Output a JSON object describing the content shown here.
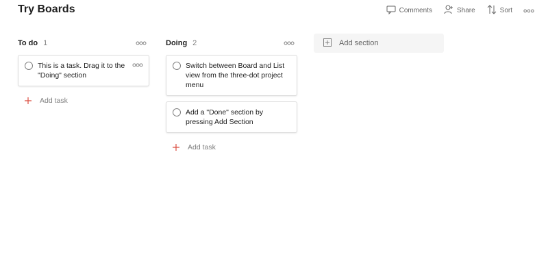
{
  "page": {
    "title": "Try Boards"
  },
  "toolbar": {
    "comments_label": "Comments",
    "share_label": "Share",
    "sort_label": "Sort"
  },
  "columns": [
    {
      "title": "To do",
      "count": "1",
      "tasks": [
        {
          "text": "This is a task. Drag it to the \"Doing\" section"
        }
      ],
      "add_task_label": "Add task"
    },
    {
      "title": "Doing",
      "count": "2",
      "tasks": [
        {
          "text": "Switch between Board and List view from the three-dot project menu"
        },
        {
          "text": "Add a \"Done\" section by pressing Add Section"
        }
      ],
      "add_task_label": "Add task"
    }
  ],
  "add_section": {
    "label": "Add section"
  },
  "colors": {
    "accent": "#db4c3f",
    "text": "#202020",
    "muted": "#808080"
  },
  "icons": [
    "comment-icon",
    "share-icon",
    "sort-icon",
    "more-icon",
    "plus-icon",
    "add-section-icon",
    "task-checkbox-icon"
  ]
}
